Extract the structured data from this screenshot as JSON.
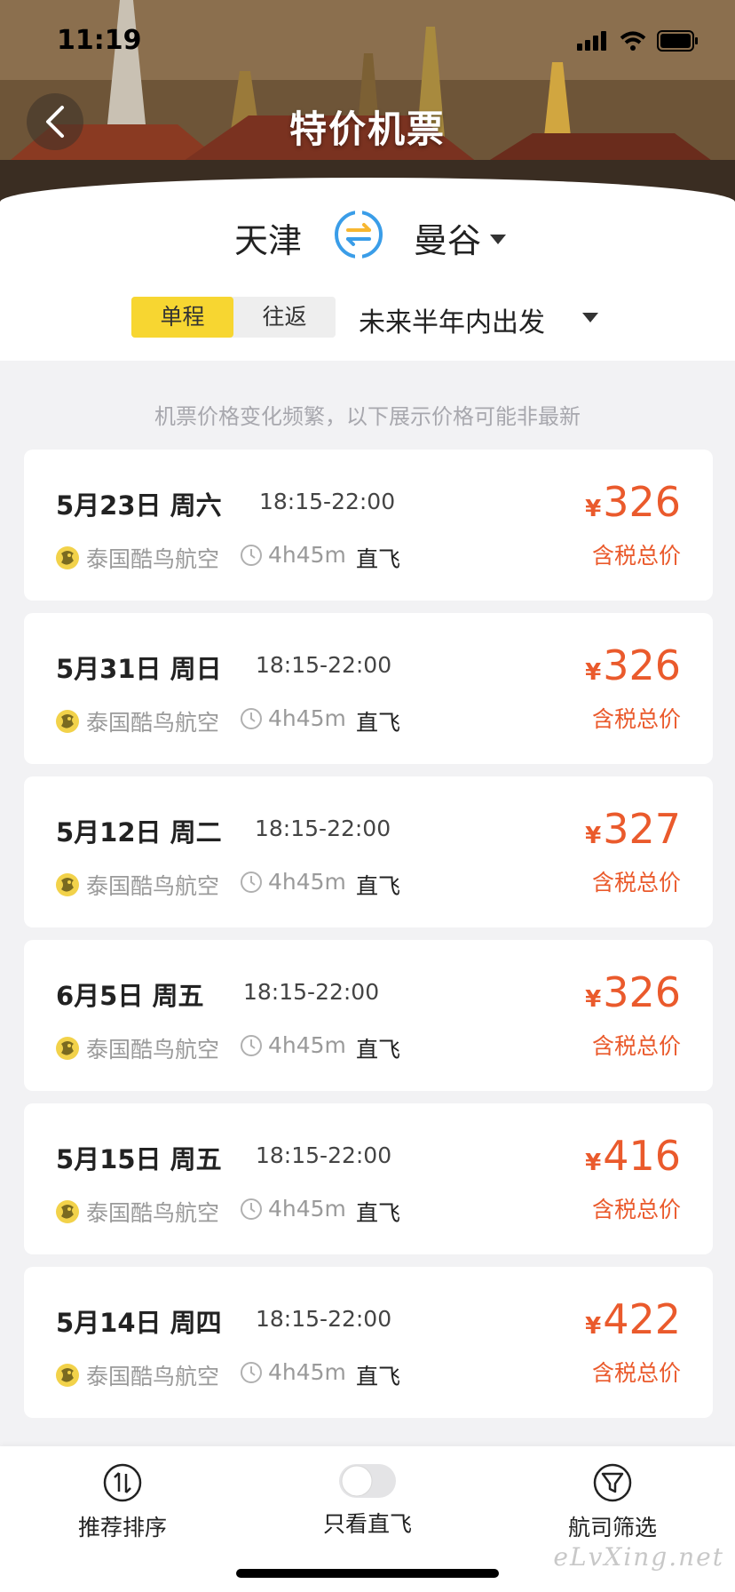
{
  "status_bar": {
    "time": "11:19"
  },
  "header": {
    "title": "特价机票",
    "back_icon": "chevron-left-icon"
  },
  "route": {
    "from_city": "天津",
    "to_city": "曼谷",
    "swap_icon": "swap-arrows-icon",
    "trip_types": [
      {
        "label": "单程",
        "active": true
      },
      {
        "label": "往返",
        "active": false
      }
    ],
    "date_range": "未来半年内出发"
  },
  "notice": "机票价格变化频繁，以下展示价格可能非最新",
  "flights": [
    {
      "date": "5月23日 周六",
      "time": "18:15-22:00",
      "airline": "泰国酷鸟航空",
      "duration": "4h45m",
      "type": "直飞",
      "currency": "¥",
      "price": "326",
      "price_note": "含税总价"
    },
    {
      "date": "5月31日 周日",
      "time": "18:15-22:00",
      "airline": "泰国酷鸟航空",
      "duration": "4h45m",
      "type": "直飞",
      "currency": "¥",
      "price": "326",
      "price_note": "含税总价"
    },
    {
      "date": "5月12日 周二",
      "time": "18:15-22:00",
      "airline": "泰国酷鸟航空",
      "duration": "4h45m",
      "type": "直飞",
      "currency": "¥",
      "price": "327",
      "price_note": "含税总价"
    },
    {
      "date": "6月5日 周五",
      "time": "18:15-22:00",
      "airline": "泰国酷鸟航空",
      "duration": "4h45m",
      "type": "直飞",
      "currency": "¥",
      "price": "326",
      "price_note": "含税总价"
    },
    {
      "date": "5月15日 周五",
      "time": "18:15-22:00",
      "airline": "泰国酷鸟航空",
      "duration": "4h45m",
      "type": "直飞",
      "currency": "¥",
      "price": "416",
      "price_note": "含税总价"
    },
    {
      "date": "5月14日 周四",
      "time": "18:15-22:00",
      "airline": "泰国酷鸟航空",
      "duration": "4h45m",
      "type": "直飞",
      "currency": "¥",
      "price": "422",
      "price_note": "含税总价"
    }
  ],
  "bottom_bar": {
    "sort_label": "推荐排序",
    "direct_only_label": "只看直飞",
    "direct_only_on": false,
    "airline_filter_label": "航司筛选"
  },
  "watermark": "eLvXing.net",
  "colors": {
    "accent_yellow": "#f7d631",
    "price_red": "#ea5a2c",
    "swap_blue": "#3a9de8"
  }
}
